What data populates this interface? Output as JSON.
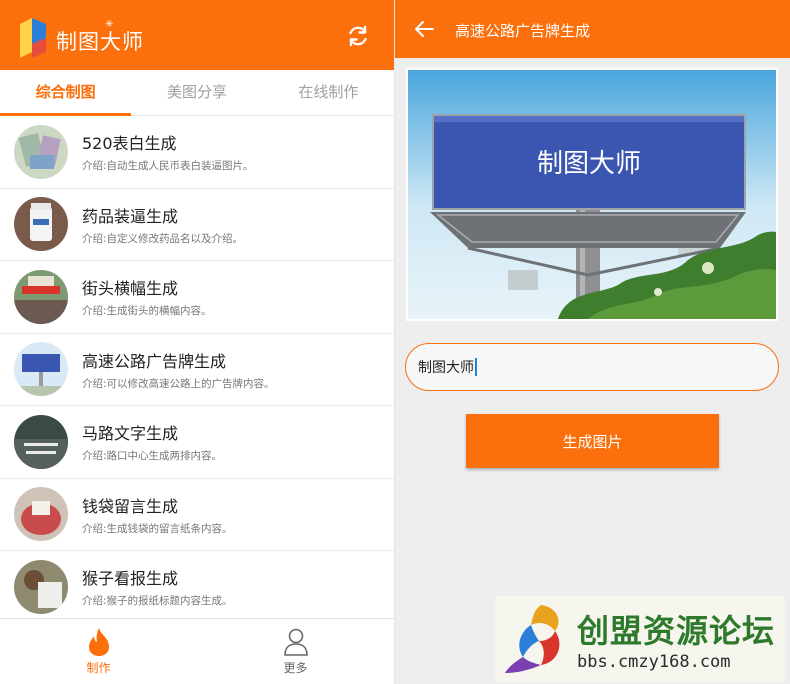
{
  "left": {
    "app_title": "制图大师",
    "tabs": [
      {
        "label": "综合制图",
        "active": true
      },
      {
        "label": "美图分享",
        "active": false
      },
      {
        "label": "在线制作",
        "active": false
      }
    ],
    "items": [
      {
        "title": "520表白生成",
        "desc": "介绍:自动生成人民币表白装逼图片。"
      },
      {
        "title": "药品装逼生成",
        "desc": "介绍:自定义修改药品名以及介绍。"
      },
      {
        "title": "街头横幅生成",
        "desc": "介绍:生成街头的横幅内容。"
      },
      {
        "title": "高速公路广告牌生成",
        "desc": "介绍:可以修改高速公路上的广告牌内容。"
      },
      {
        "title": "马路文字生成",
        "desc": "介绍:路口中心生成两排内容。"
      },
      {
        "title": "钱袋留言生成",
        "desc": "介绍:生成钱袋的留言纸条内容。"
      },
      {
        "title": "猴子看报生成",
        "desc": "介绍:猴子的报纸标题内容生成。"
      }
    ],
    "bottom_nav": [
      {
        "label": "制作",
        "icon": "flame-icon",
        "active": true
      },
      {
        "label": "更多",
        "icon": "user-icon",
        "active": false
      }
    ]
  },
  "right": {
    "title": "高速公路广告牌生成",
    "billboard_text": "制图大师",
    "input_value": "制图大师",
    "generate_label": "生成图片"
  },
  "watermark": {
    "name": "创盟资源论坛",
    "url": "bbs.cmzy168.com"
  },
  "colors": {
    "accent": "#fb6f0c",
    "billboard_blue": "#3a56b0"
  }
}
